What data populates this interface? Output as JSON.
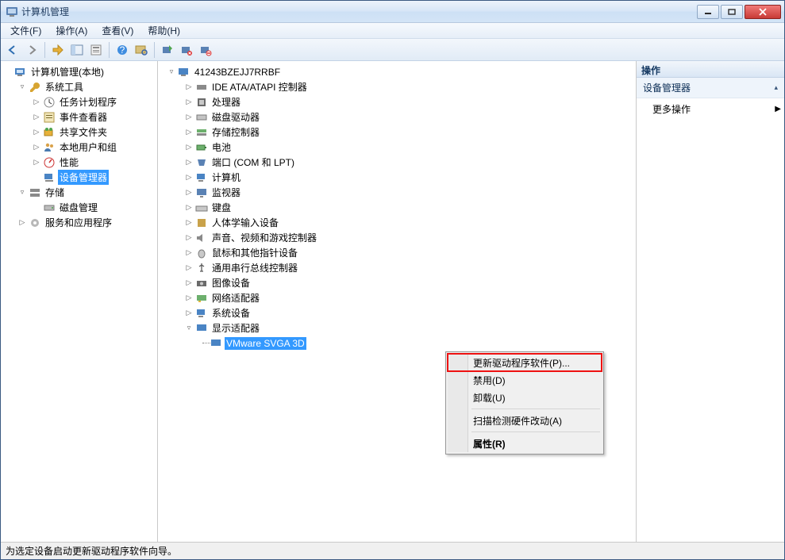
{
  "window": {
    "title": "计算机管理"
  },
  "menu": {
    "file": "文件(F)",
    "action": "操作(A)",
    "view": "查看(V)",
    "help": "帮助(H)"
  },
  "left_tree": {
    "root": "计算机管理(本地)",
    "system_tools": "系统工具",
    "task_scheduler": "任务计划程序",
    "event_viewer": "事件查看器",
    "shared_folders": "共享文件夹",
    "local_users": "本地用户和组",
    "performance": "性能",
    "device_manager": "设备管理器",
    "storage": "存储",
    "disk_management": "磁盘管理",
    "services_apps": "服务和应用程序"
  },
  "center_tree": {
    "computer": "41243BZEJJ7RRBF",
    "ide": "IDE ATA/ATAPI 控制器",
    "processor": "处理器",
    "disk_drives": "磁盘驱动器",
    "storage_ctrl": "存储控制器",
    "battery": "电池",
    "ports": "端口 (COM 和 LPT)",
    "computers": "计算机",
    "monitors": "监视器",
    "keyboards": "键盘",
    "hid": "人体学输入设备",
    "sound": "声音、视频和游戏控制器",
    "mice": "鼠标和其他指针设备",
    "usb": "通用串行总线控制器",
    "imaging": "图像设备",
    "network": "网络适配器",
    "system_devices": "系统设备",
    "display_adapters": "显示适配器",
    "vmware_svga": "VMware SVGA 3D"
  },
  "ctx": {
    "update": "更新驱动程序软件(P)...",
    "disable": "禁用(D)",
    "uninstall": "卸载(U)",
    "scan": "扫描检测硬件改动(A)",
    "properties": "属性(R)"
  },
  "actions": {
    "header": "操作",
    "group": "设备管理器",
    "more": "更多操作"
  },
  "status": "为选定设备启动更新驱动程序软件向导。"
}
